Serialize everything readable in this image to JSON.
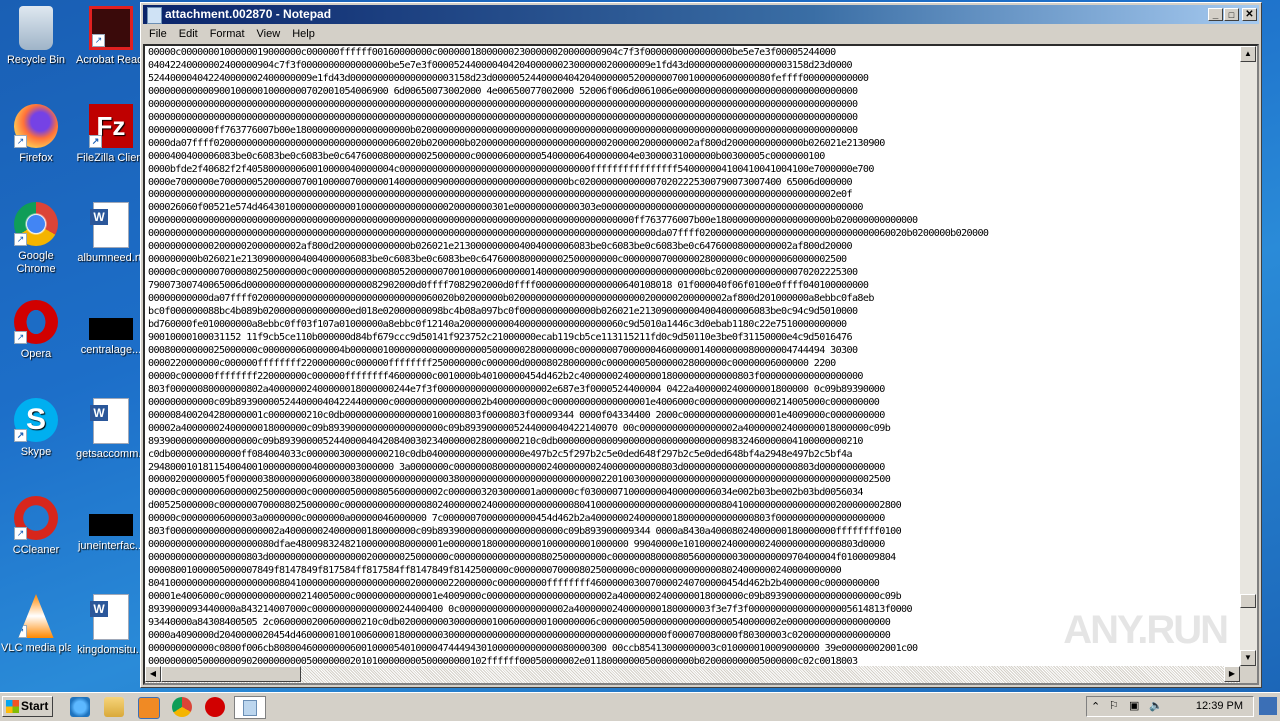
{
  "desktop": {
    "icons": [
      {
        "label": "Recycle Bin",
        "icon": "recycle-bin-icon"
      },
      {
        "label": "Acrobat Reader DC",
        "icon": "acrobat-reader-icon"
      },
      {
        "label": "Firefox",
        "icon": "firefox-icon"
      },
      {
        "label": "FileZilla Client",
        "icon": "filezilla-icon"
      },
      {
        "label": "Google Chrome",
        "icon": "chrome-icon"
      },
      {
        "label": "albumneed.rtf",
        "icon": "word-document-icon"
      },
      {
        "label": "Opera",
        "icon": "opera-icon"
      },
      {
        "label": "centralage...",
        "icon": "black-file-icon"
      },
      {
        "label": "Skype",
        "icon": "skype-icon"
      },
      {
        "label": "getsaccomm...",
        "icon": "word-document-icon"
      },
      {
        "label": "CCleaner",
        "icon": "ccleaner-icon"
      },
      {
        "label": "juneinterfac...",
        "icon": "black-file-icon"
      },
      {
        "label": "VLC media player",
        "icon": "vlc-icon"
      },
      {
        "label": "kingdomsitu...",
        "icon": "word-document-icon"
      }
    ]
  },
  "window": {
    "title": "attachment.002870 - Notepad",
    "buttons": {
      "minimize": "_",
      "maximize": "□",
      "close": "✕"
    },
    "menu": [
      "File",
      "Edit",
      "Format",
      "View",
      "Help"
    ],
    "lines": [
      "00000c0000000100000019000000c000000ffffff00160000000c000000180000002300000020000000904c7f3f0000000000000000be5e7e3f00005244000",
      "04042240000002400000904c7f3f0000000000000000be5e7e3f0000524400004042040000002300000020000009e1fd43d0000000000000000003158d23d0000",
      "524400004042240000002400000009e1fd43d0000000000000000003158d23d000005244000040420400000052000000700100000600000080feffff000000000000",
      "00000000000090010000010000000702001054006900 6d00650073002000 4e00650077002000 52006f006d0061006e000000000000000000000000000000000",
      "0000000000000000000000000000000000000000000000000000000000000000000000000000000000000000000000000000000000000000000000000000000000",
      "0000000000000000000000000000000000000000000000000000000000000000000000000000000000000000000000000000000000000000000000000000000000",
      "000000000000ff763776007b00e180000000000000000000b020000000000000000000000000000000000000000000000000000000000000000000000000000000",
      "0000da07ffff02000000000000000000000000000000060020b0200000b02000000000000000000000002000002000000002af800d20000000000000b026021e2130900",
      "0000400400006083be0c6083be0c6083be0c64760008000000025000000c00000600000054000006400000004e03000031000000b00300005c0000000100",
      "0000bfde2f40682f2f405800000060010000040000004c00000000000000000000000000000000000ffffffffffffffff540000004100410041004100e7000000e700",
      "0000e7000000e7000000520000007001000007000000140000000900000000000000000000000bc0200000000000070202225300790073007400 65006d000000",
      "000000000000000000000000000000000000000000000000000000000000000000000000000000000000000000000000000000000000000000000000000002e0f",
      "000026060f00521e574d4643010000000000001000000000000000020000000301e000000000000303e000000000000000000000000000000000000000000000000",
      "00000000000000000000000000000000000000000000000000000000000000000000000000000000000000000ff763776007b00e180000000000000000000b020000000000000",
      "000000000000000000000000000000000000000000000000000000000000000000000000000000000000000000000da07ffff02000000000000000000000000000000060020b0200000b020000",
      "0000000000002000002000000002af800d20000000000000b026021e2130000000004004000006083be0c6083be0c6083be0c64760008000000002af800d20000",
      "000000000b026021e213090000004004000006083be0c6083be0c6083be0c6476000800000002500000000c0000000700000028000000c000000060000002500",
      "00000c00000007000080250000000c000000000000008052000000700100000600000014000000090000000000000000000000bc02000000000000070202225300",
      "79007300740065006d0000000000000000000000082902000d0ffff7082902000d0ffff0000000000000000640108018 01f000040f06f0100e0ffff040100000000",
      "00000000000da07ffff0200000000000000000000000000000060020b02000000b0200000000000000000000000200000200000002af800d201000000a8ebbc0fa8eb",
      "bc0f000000088bc4b089b0200000000000000ed018e02000000098bc4b08a097bc0f00000000000000b026021e213090000004004000006083be0c94c9d5010000",
      "bd760000fe010000000a8ebbc0ff03f107a01000000a8ebbc0f12140a200000000040000000000000000060c9d5010a1446c3d0ebab1180c22e7510000000000",
      "90010000100031152 11f9cb5ce110b000000d84bf679ccc9d50141f923752c21000000ecab119cb5ce113115211fd0c9d50110e3be0f31150000e4c9d5016476",
      "00080000000025000000c000000060000004b00000010000000000000000005000000280000000c000000070000004600000014000000080000004744494 30300",
      "0000220000000c000000ffffffff220000000c000000ffffffff250000000c000000d00008028000000c0000000500000028000000c00000006000000 2200",
      "00000c000000ffffffff220000000c000000ffffffff46000000c0010000b40100000454d462b2c40000002400000018000000000000803f0000000000000000000",
      "803f00000080000000802a40000002400000018000000244e7f3f000000000000000000002e687e3f0000524400004 0422a400000240000001800000 0c09b89390000",
      "000000000000c09b8939000052440000404224400000c00000000000000002b4000000000c000000000000000001e4006000c00000000000000214005000c000000000",
      "000008400204280000001c0000000210c0db0000000000000000100000803f0000803f00009344 0000f04334400 2000c000000000000000001e4009000c0000000000",
      "00002a40000002400000018000000c09b893900000000000000000c09b8939000005244000040422140070 00c000000000000000002a40000002400000018000000c09b",
      "89390000000000000000c09b89390000524400004042084003023400000028000000210c0db00000000000900000000000000000009832460000004100000000210",
      "c0db0000000000000ff084004033c000000300000000210c0db040000000000000000e497b2c5f297b2c5e0ded648f297b2c5e0ded648bf4a2948e497b2c5bf4a",
      "294800010181154004001000000000400000003000000 3a0000000c00000008000000000240000000240000000000803d000000000000000000000803d000000000000",
      "00000200000005f0000003800000006000000380000000000000000380000000000000000000000000022010030000000000000000000000000000000000000000002500",
      "00000c00000006000000250000000c000000050000805600000002c0000003203000001a000000cf030000710000000400000006034e002b03be002b03bd0056034",
      "d00525000000c0000000700008025000000c000000000000000802400000024000000000000000804100000000000000000000000804100000000000000000200000002800",
      "00000c00000006000003a0000000c0000000a00000046000000 7c00000070000000000454d462b2a400000024000000180000000000000803f00000000000000000000",
      "803f00000000000000000002a400000024000000180000000c09b89390000000000000000000c09b893900009344 0000a8430a40008024000000180000000ffffffff0100",
      "00000000000000000000080dfae480098324821000000080000001e000000180000000001000000001000000 99040000e10100002400000024000000000000803d0000",
      "000000000000000000803d000000000000000000200000025000000c0000000000000000802500000000c00000008000080560000000300000000970400004f0100009804",
      "00008001000005000007849f8147849f817584ff817584ff8147849f8142500000c0000000700008025000000c0000000000000008024000000240000000000",
      "804100000000000000000000804100000000000000000000200000022000000c000000000ffffffff4600000030070000240700000454d462b2b4000000c0000000000",
      "00001e4006000c00000000000000214005000c000000000000001e4009000c00000000000000000000002a40000002400000018000000c09b893900000000000000000c09b",
      "8939000093440000a843214007000c000000000000000024400400 0c00000000000000000002a4000000240000000180000003f3e7f3f0000000000000000005614813f0000",
      "93440000a84308400505 2c0600000200600000210c0db020000000300000001006000000100000006c000000050000000000000000540000002e0000000000000000000",
      "0000a4090000d2040000020454d46000001001006000018000000030000000000000000000000000000000000000000f000070080000f80300003c020000000000000000",
      "000000000000c0800f006cb8080046000000060010000540100004744494301000000000000080000300 00ccb85413000000003c010000010009000000 39e00000002001c00",
      "00000000050000000902000000000500000002010100000000500000000102ffffff00050000002e01180000000500000000b020000000005000000c02c0018003"
    ]
  },
  "taskbar": {
    "start_label": "Start",
    "apps": [
      "internet-explorer-icon",
      "file-explorer-icon",
      "media-player-icon",
      "chrome-icon",
      "opera-icon",
      "notepad-icon"
    ],
    "clock": "12:39 PM"
  },
  "watermark": "ANY.RUN"
}
